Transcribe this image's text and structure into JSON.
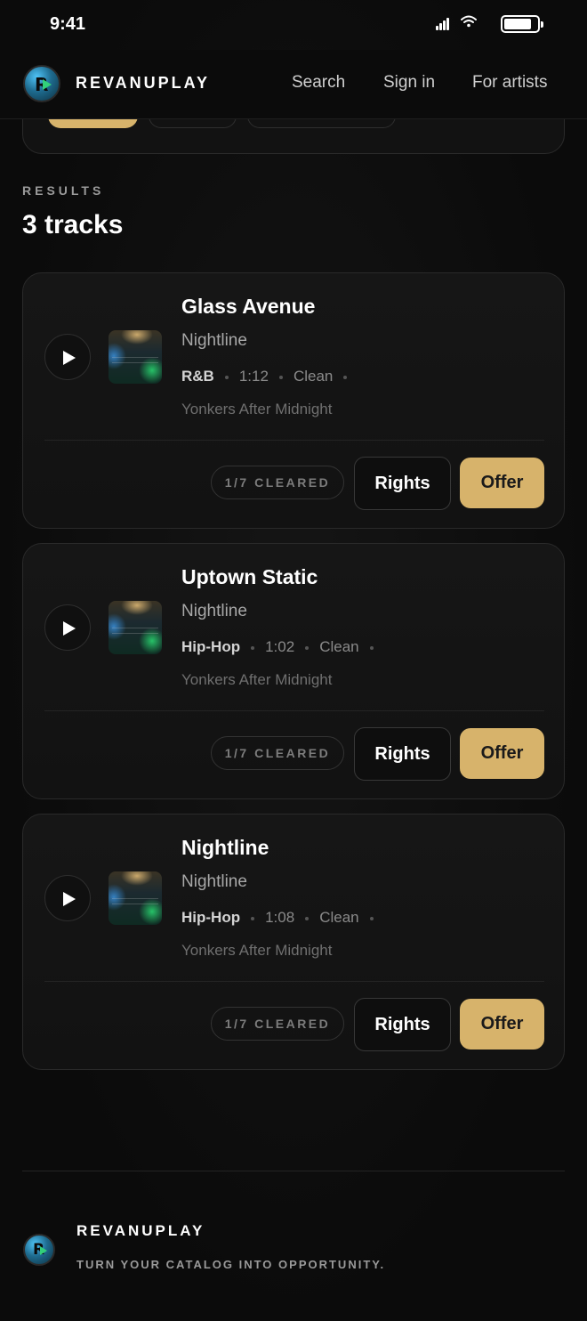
{
  "status_bar": {
    "time": "9:41"
  },
  "header": {
    "brand": "REVANUPLAY",
    "nav": [
      "Search",
      "Sign in",
      "For artists"
    ]
  },
  "results": {
    "label": "RESULTS",
    "count": "3 tracks"
  },
  "tracks": [
    {
      "title": "Glass Avenue",
      "artist": "Nightline",
      "genre": "R&B",
      "duration": "1:12",
      "rating": "Clean",
      "album": "Yonkers After Midnight",
      "cleared": "1/7 CLEARED",
      "rights_label": "Rights",
      "offer_label": "Offer"
    },
    {
      "title": "Uptown Static",
      "artist": "Nightline",
      "genre": "Hip-Hop",
      "duration": "1:02",
      "rating": "Clean",
      "album": "Yonkers After Midnight",
      "cleared": "1/7 CLEARED",
      "rights_label": "Rights",
      "offer_label": "Offer"
    },
    {
      "title": "Nightline",
      "artist": "Nightline",
      "genre": "Hip-Hop",
      "duration": "1:08",
      "rating": "Clean",
      "album": "Yonkers After Midnight",
      "cleared": "1/7 CLEARED",
      "rights_label": "Rights",
      "offer_label": "Offer"
    }
  ],
  "footer": {
    "brand": "REVANUPLAY",
    "tagline": "TURN YOUR CATALOG INTO OPPORTUNITY."
  },
  "colors": {
    "accent": "#d7b36b",
    "background": "#0b0b0b",
    "card": "#141414"
  },
  "icons": {
    "play": "play-icon",
    "logo": "revanuplay-logo"
  }
}
